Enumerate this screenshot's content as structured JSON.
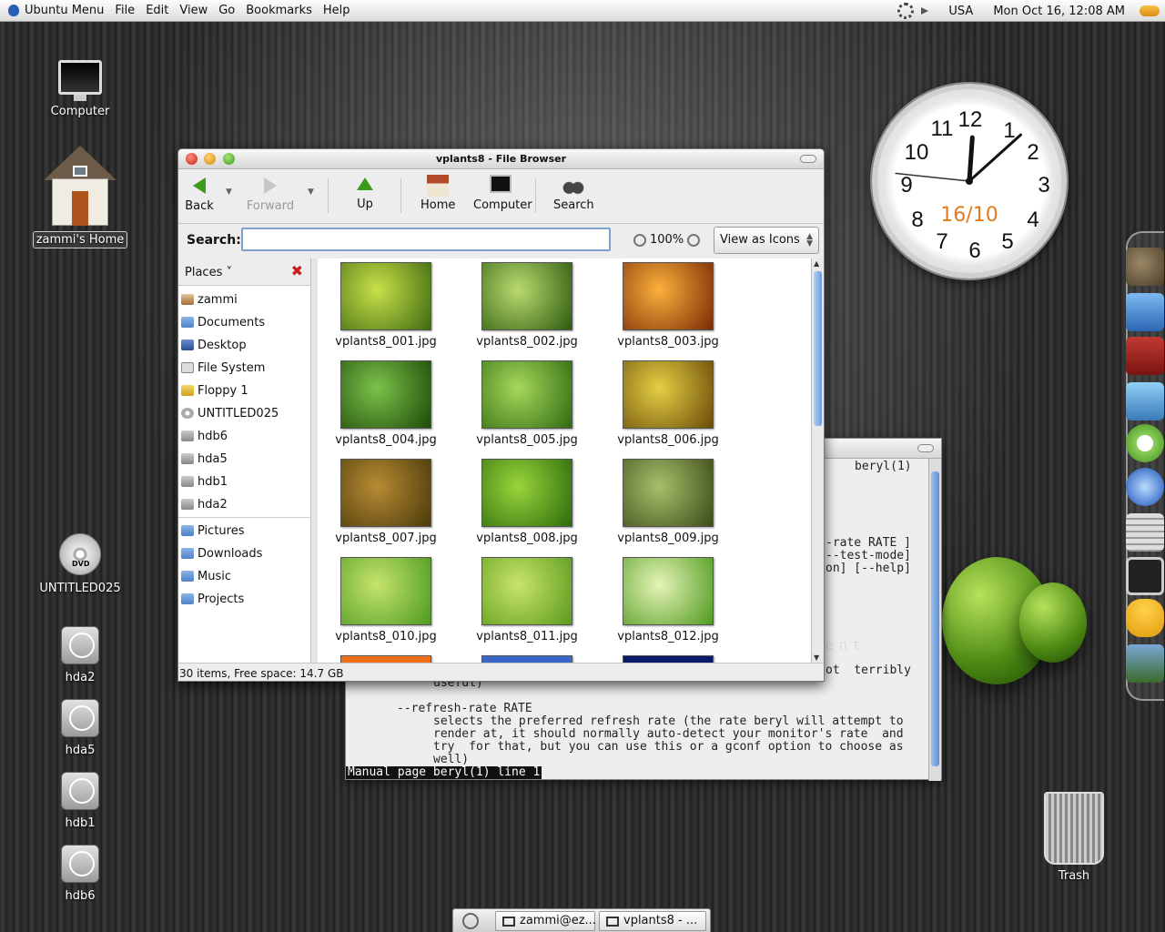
{
  "top_panel": {
    "app_menu": "Ubuntu Menu",
    "menus": [
      "File",
      "Edit",
      "View",
      "Go",
      "Bookmarks",
      "Help"
    ],
    "keyboard_layout": "USA",
    "datetime": "Mon Oct 16, 12:08 AM"
  },
  "desktop_icons": {
    "computer": "Computer",
    "home": "zammi's Home",
    "dvd": "UNTITLED025",
    "dvd_badge": "DVD",
    "hda2": "hda2",
    "hda5": "hda5",
    "hdb1": "hdb1",
    "hdb6": "hdb6",
    "trash": "Trash"
  },
  "clock": {
    "numbers": [
      "12",
      "1",
      "2",
      "3",
      "4",
      "5",
      "6",
      "7",
      "8",
      "9",
      "10",
      "11"
    ],
    "date": "16/10",
    "time": {
      "hour": 12,
      "minute": 8,
      "second": 46
    }
  },
  "file_browser": {
    "title": "vplants8 - File Browser",
    "toolbar": {
      "back": "Back",
      "forward": "Forward",
      "up": "Up",
      "home": "Home",
      "computer": "Computer",
      "search": "Search"
    },
    "search_label": "Search:",
    "search_value": "",
    "zoom": "100%",
    "view_mode": "View as Icons",
    "places_label": "Places",
    "places": [
      "zammi",
      "Documents",
      "Desktop",
      "File System",
      "Floppy 1",
      "UNTITLED025",
      "hdb6",
      "hda5",
      "hdb1",
      "hda2"
    ],
    "bookmarks": [
      "Pictures",
      "Downloads",
      "Music",
      "Projects"
    ],
    "files": [
      {
        "name": "vplants8_001.jpg",
        "colors": [
          "#c9e04a",
          "#3f6b10"
        ]
      },
      {
        "name": "vplants8_002.jpg",
        "colors": [
          "#b9da6e",
          "#2d5a0f"
        ]
      },
      {
        "name": "vplants8_003.jpg",
        "colors": [
          "#fbb03b",
          "#7a2a05"
        ]
      },
      {
        "name": "vplants8_004.jpg",
        "colors": [
          "#7cc24a",
          "#1d4a08"
        ]
      },
      {
        "name": "vplants8_005.jpg",
        "colors": [
          "#a6d85a",
          "#2f6a11"
        ]
      },
      {
        "name": "vplants8_006.jpg",
        "colors": [
          "#e4d044",
          "#6a4a08"
        ]
      },
      {
        "name": "vplants8_007.jpg",
        "colors": [
          "#b78b33",
          "#4a3a0a"
        ]
      },
      {
        "name": "vplants8_008.jpg",
        "colors": [
          "#9ad53b",
          "#2b6a0c"
        ]
      },
      {
        "name": "vplants8_009.jpg",
        "colors": [
          "#a7c06a",
          "#3b4a18"
        ]
      },
      {
        "name": "vplants8_010.jpg",
        "colors": [
          "#c6e46c",
          "#4c9a22"
        ]
      },
      {
        "name": "vplants8_011.jpg",
        "colors": [
          "#c8e46a",
          "#5a9a1c"
        ]
      },
      {
        "name": "vplants8_012.jpg",
        "colors": [
          "#e6f4b8",
          "#4e9a1e"
        ]
      }
    ],
    "partial_row_colors": [
      "#f0701a",
      "#3a66c8",
      "#0a1a6a"
    ],
    "status": "30 items, Free space: 14.7 GB"
  },
  "terminal": {
    "header": "beryl(1)",
    "lines": [
      "-rate RATE ]",
      "--test-mode]",
      "on] [--help]",
      "ent",
      "ot  terribly",
      "useful)",
      "--refresh-rate RATE",
      "selects the preferred refresh rate (the rate beryl will attempt to",
      "render at, it should normally auto-detect your monitor's rate  and",
      "try  for that, but you can use this or a gconf option to choose as",
      "well)"
    ],
    "status": "Manual page beryl(1) line 1"
  },
  "taskbar": {
    "terminal_task": "zammi@ez...",
    "browser_task": "vplants8 - ..."
  },
  "colors": {
    "accent_blue": "#7da2ce",
    "clock_date": "#e27b1d",
    "places_close": "#c81d1d"
  }
}
